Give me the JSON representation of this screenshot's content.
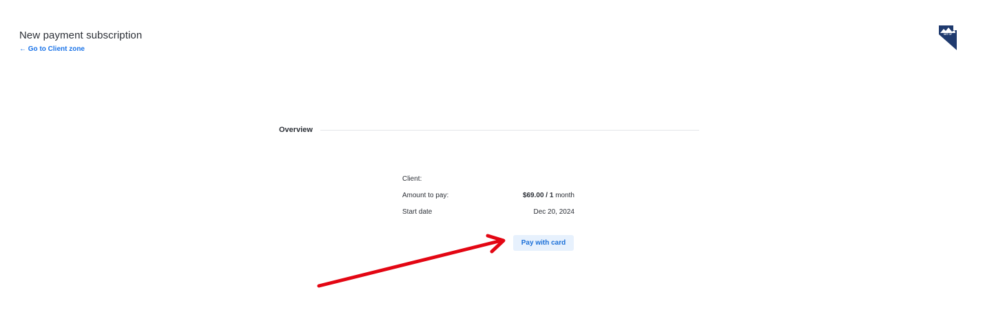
{
  "header": {
    "title": "New payment subscription",
    "back_link": "← Go to Client zone"
  },
  "logo": {
    "icon": "state-outline-mountain-logo",
    "text": "NET OF"
  },
  "overview": {
    "title": "Overview"
  },
  "summary": {
    "client_label": "Client:",
    "client_value": "",
    "amount_label": "Amount to pay:",
    "amount_price": "$69.00 / 1",
    "amount_period": " month",
    "start_label": "Start date",
    "start_value": "Dec 20, 2024"
  },
  "actions": {
    "pay_button": "Pay with card"
  },
  "annotation": {
    "arrow_color": "#e30613"
  },
  "colors": {
    "link": "#1a73e8",
    "button_bg": "#e7f1fd",
    "logo": "#1f3a6e"
  }
}
